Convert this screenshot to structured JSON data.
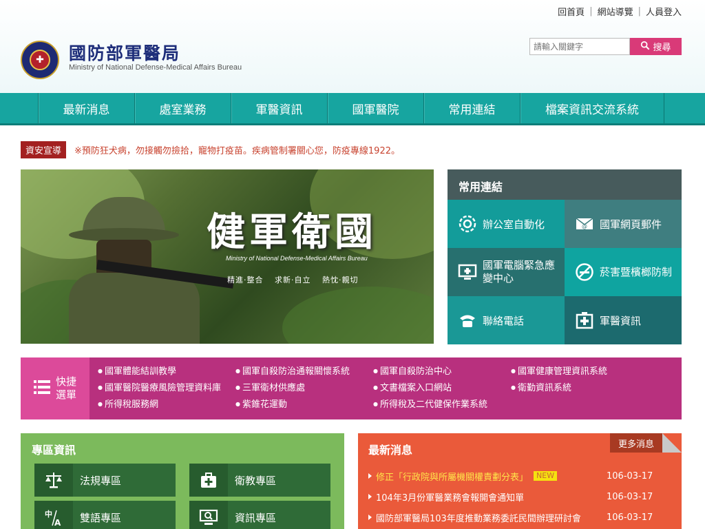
{
  "header": {
    "top_links": [
      "回首頁",
      "網站導覽",
      "人員登入"
    ],
    "title": "國防部軍醫局",
    "subtitle": "Ministry of National Defense-Medical Affairs Bureau",
    "search_placeholder": "請輸入關鍵字",
    "search_button": "搜尋"
  },
  "nav": {
    "items": [
      "最新消息",
      "處室業務",
      "軍醫資訊",
      "國軍醫院",
      "常用連結",
      "檔案資訊交流系統"
    ]
  },
  "announcement": {
    "badge": "資安宣導",
    "text": "※預防狂犬病，勿接觸勿撿拾，寵物打疫苗。疾病管制署關心您，防疫專線1922。"
  },
  "banner": {
    "title": "健軍衛國",
    "subtitle": "Ministry of National Defense-Medical Affairs Bureau",
    "motto": "精進‧整合 求新‧自立 熱忱‧親切"
  },
  "common_links": {
    "heading": "常用連結",
    "items": [
      {
        "label": "辦公室自動化",
        "icon": "gear-icon"
      },
      {
        "label": "國軍網頁郵件",
        "icon": "email-icon"
      },
      {
        "label": "國軍電腦緊急應變中心",
        "icon": "monitor-medical-icon"
      },
      {
        "label": "菸害暨檳榔防制",
        "icon": "no-smoking-icon"
      },
      {
        "label": "聯絡電話",
        "icon": "phone-icon"
      },
      {
        "label": "軍醫資訊",
        "icon": "hospital-icon"
      }
    ]
  },
  "quick_menu": {
    "label_line1": "快捷",
    "label_line2": "選單",
    "items": [
      "國軍體能結訓教學",
      "國軍自殺防治通報關懷系統",
      "國軍自殺防治中心",
      "國軍健康管理資訊系統",
      "國軍醫院醫療風險管理資料庫",
      "三軍衛材供應處",
      "文書檔案入口網站",
      "衛勤資訊系統",
      "所得稅服務網",
      "紫錐花運動",
      "所得稅及二代健保作業系統"
    ]
  },
  "topics": {
    "heading": "專區資訊",
    "items": [
      {
        "label": "法規專區",
        "icon": "scales-icon"
      },
      {
        "label": "衛教專區",
        "icon": "first-aid-kit-icon"
      },
      {
        "label": "雙語專區",
        "icon": "bilingual-icon"
      },
      {
        "label": "資訊專區",
        "icon": "computer-search-icon"
      }
    ]
  },
  "news": {
    "heading": "最新消息",
    "more": "更多消息",
    "new_badge": "NEW",
    "items": [
      {
        "title": "修正「行政院與所屬機關權責劃分表」",
        "date": "106-03-17",
        "highlight": true
      },
      {
        "title": "104年3月份軍醫業務會報開會通知單",
        "date": "106-03-17",
        "highlight": false
      },
      {
        "title": "國防部軍醫局103年度推動業務委託民間辦理研討會",
        "date": "106-03-17",
        "highlight": false
      }
    ]
  },
  "colors": {
    "nav_teal": "#17a5a0",
    "quick_magenta": "#b8307e",
    "topics_green": "#7cba5c",
    "news_orange": "#ea5a3a",
    "search_pink": "#d93a78"
  }
}
